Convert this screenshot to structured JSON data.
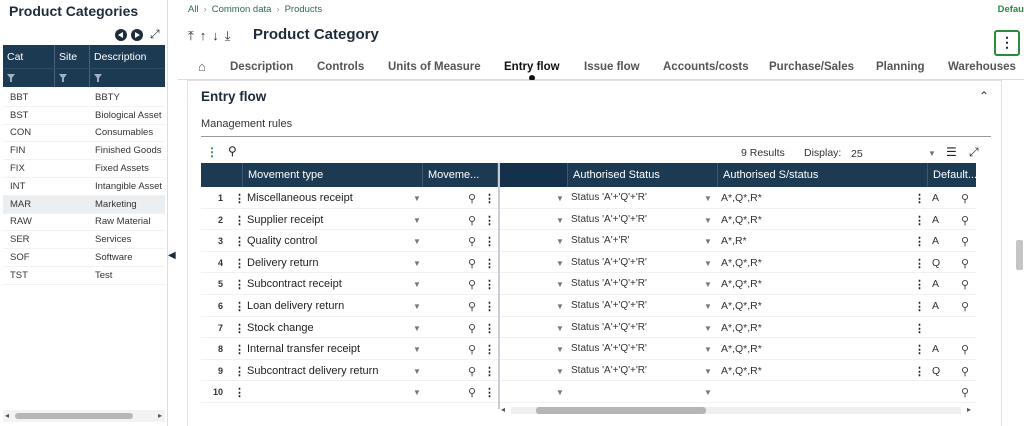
{
  "left_panel": {
    "title": "Product Categories",
    "columns": [
      "Cat",
      "Site",
      "Description"
    ],
    "rows": [
      {
        "cat": "BBT",
        "site": "",
        "description": "BBTY"
      },
      {
        "cat": "BST",
        "site": "",
        "description": "Biological Asset"
      },
      {
        "cat": "CON",
        "site": "",
        "description": "Consumables"
      },
      {
        "cat": "FIN",
        "site": "",
        "description": "Finished Goods"
      },
      {
        "cat": "FIX",
        "site": "",
        "description": "Fixed Assets"
      },
      {
        "cat": "INT",
        "site": "",
        "description": "Intangible Asset"
      },
      {
        "cat": "MAR",
        "site": "",
        "description": "Marketing"
      },
      {
        "cat": "RAW",
        "site": "",
        "description": "Raw Material"
      },
      {
        "cat": "SER",
        "site": "",
        "description": "Services"
      },
      {
        "cat": "SOF",
        "site": "",
        "description": "Software"
      },
      {
        "cat": "TST",
        "site": "",
        "description": "Test"
      }
    ],
    "selected_row": "MAR"
  },
  "breadcrumb": [
    "All",
    "Common data",
    "Products"
  ],
  "folder_label": "Defau",
  "page_title": "Product Category",
  "tabs": [
    "Description",
    "Controls",
    "Units of Measure",
    "Entry flow",
    "Issue flow",
    "Accounts/costs",
    "Purchase/Sales",
    "Planning",
    "Warehouses"
  ],
  "active_tab": "Entry flow",
  "section_title": "Entry flow",
  "subsection_title": "Management rules",
  "grid_toolbar": {
    "results": "9 Results",
    "display_label": "Display:",
    "display_value": "25"
  },
  "grid": {
    "columns": [
      "Movement type",
      "Moveme...",
      "Authorised Status",
      "Authorised S/status",
      "Default..."
    ],
    "rows": [
      {
        "num": "1",
        "movement_type": "Miscellaneous receipt",
        "auth_status": "Status 'A'+'Q'+'R'",
        "auth_substatus": "A*,Q*,R*",
        "default": "A"
      },
      {
        "num": "2",
        "movement_type": "Supplier receipt",
        "auth_status": "Status 'A'+'Q'+'R'",
        "auth_substatus": "A*,Q*,R*",
        "default": "A"
      },
      {
        "num": "3",
        "movement_type": "Quality control",
        "auth_status": "Status 'A'+'R'",
        "auth_substatus": "A*,R*",
        "default": "A"
      },
      {
        "num": "4",
        "movement_type": "Delivery return",
        "auth_status": "Status 'A'+'Q'+'R'",
        "auth_substatus": "A*,Q*,R*",
        "default": "Q"
      },
      {
        "num": "5",
        "movement_type": "Subcontract receipt",
        "auth_status": "Status 'A'+'Q'+'R'",
        "auth_substatus": "A*,Q*,R*",
        "default": "A"
      },
      {
        "num": "6",
        "movement_type": "Loan delivery return",
        "auth_status": "Status 'A'+'Q'+'R'",
        "auth_substatus": "A*,Q*,R*",
        "default": "A"
      },
      {
        "num": "7",
        "movement_type": "Stock change",
        "auth_status": "Status 'A'+'Q'+'R'",
        "auth_substatus": "A*,Q*,R*",
        "default": ""
      },
      {
        "num": "8",
        "movement_type": "Internal transfer receipt",
        "auth_status": "Status 'A'+'Q'+'R'",
        "auth_substatus": "A*,Q*,R*",
        "default": "A"
      },
      {
        "num": "9",
        "movement_type": "Subcontract delivery return",
        "auth_status": "Status 'A'+'Q'+'R'",
        "auth_substatus": "A*,Q*,R*",
        "default": "Q"
      },
      {
        "num": "10",
        "movement_type": "",
        "auth_status": "",
        "auth_substatus": "",
        "default": ""
      }
    ]
  },
  "colors": {
    "header_bg": "#1d3a53",
    "accent_green": "#2a8a3e"
  }
}
